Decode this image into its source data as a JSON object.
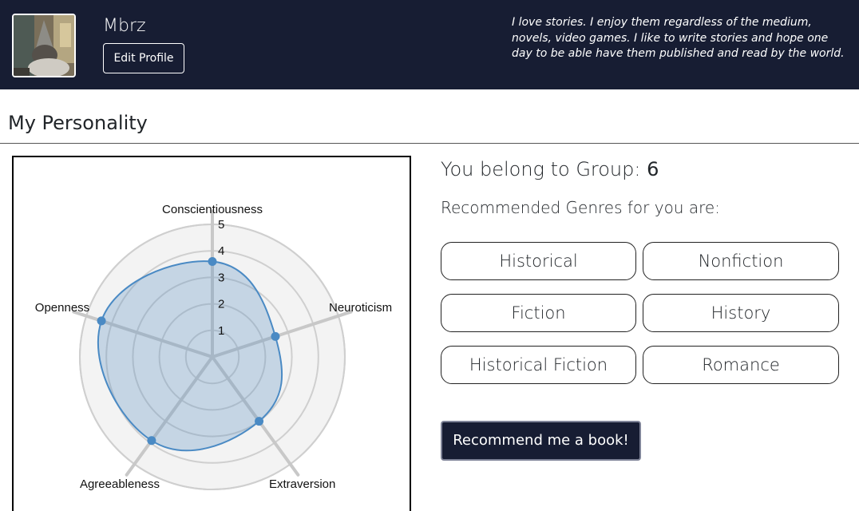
{
  "profile": {
    "username": "Mbrz",
    "edit_button_label": "Edit Profile",
    "bio": "I love stories. I enjoy them regardless of the medium, novels, video games. I like to write stories and hope one day to be able have them published and read by the world."
  },
  "section": {
    "title": "My Personality"
  },
  "group": {
    "prefix": "You belong to Group:",
    "number": "6"
  },
  "recommendations": {
    "title": "Recommended Genres for you are:",
    "genres": [
      "Historical",
      "Nonfiction",
      "Fiction",
      "History",
      "Historical Fiction",
      "Romance"
    ]
  },
  "cta": {
    "label": "Recommend me a book!"
  },
  "colors": {
    "header_bg": "#171d33",
    "radar_stroke": "#4a8ac4",
    "radar_fill": "rgba(100,150,195,0.32)"
  },
  "chart_data": {
    "type": "radar",
    "categories": [
      "Conscientiousness",
      "Neuroticism",
      "Extraversion",
      "Agreeableness",
      "Openness"
    ],
    "series": [
      {
        "values": [
          3.6,
          2.5,
          3.0,
          3.9,
          4.4
        ]
      }
    ],
    "r_ticks": [
      "1",
      "2",
      "3",
      "4",
      "5"
    ],
    "r_range": [
      0,
      5
    ],
    "grid": true,
    "legend": "none"
  }
}
